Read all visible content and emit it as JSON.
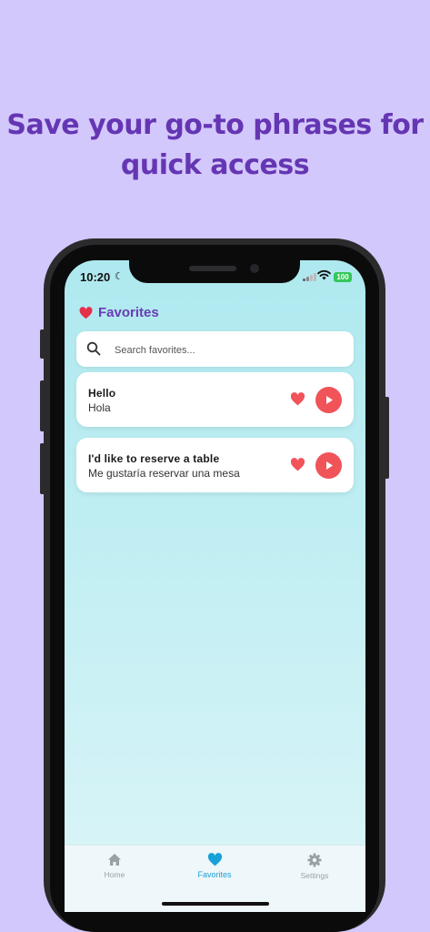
{
  "headline": {
    "line1": "Save your go-to phrases for",
    "line2": "quick access"
  },
  "status_bar": {
    "time": "10:20",
    "battery": "100"
  },
  "page": {
    "title": "Favorites"
  },
  "search": {
    "placeholder": "Search favorites..."
  },
  "favorites": [
    {
      "phrase": "Hello",
      "translation": "Hola"
    },
    {
      "phrase": "I'd like to reserve a table",
      "translation": "Me gustaría reservar una mesa"
    }
  ],
  "tabs": [
    {
      "label": "Home",
      "icon": "home-icon",
      "active": false
    },
    {
      "label": "Favorites",
      "icon": "heart-icon",
      "active": true
    },
    {
      "label": "Settings",
      "icon": "gear-icon",
      "active": false
    }
  ],
  "colors": {
    "background": "#d3c8fb",
    "headline": "#6536b3",
    "title": "#6a3cb5",
    "accent_red": "#f05358",
    "active_tab": "#19a1d9"
  }
}
